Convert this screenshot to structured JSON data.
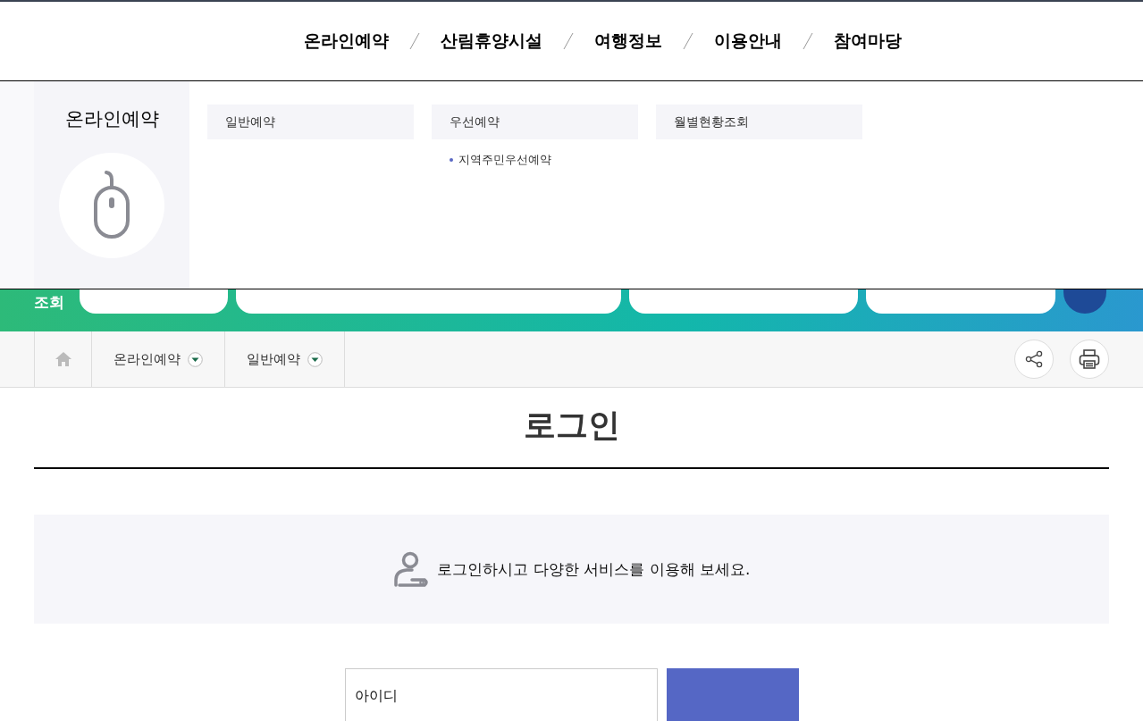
{
  "top_nav": [
    {
      "label": "온라인예약"
    },
    {
      "label": "산림휴양시설"
    },
    {
      "label": "여행정보"
    },
    {
      "label": "이용안내"
    },
    {
      "label": "참여마당"
    }
  ],
  "mega_menu": {
    "title": "온라인예약",
    "columns": [
      {
        "label": "일반예약"
      },
      {
        "label": "우선예약",
        "children": [
          {
            "label": "지역주민우선예약"
          }
        ]
      },
      {
        "label": "월별현황조회"
      }
    ]
  },
  "search_bar": {
    "label": "조회"
  },
  "breadcrumb": [
    {
      "label": "온라인예약"
    },
    {
      "label": "일반예약"
    }
  ],
  "page_title": "로그인",
  "notice": "로그인하시고 다양한 서비스를 이용해 보세요.",
  "login_form": {
    "id_placeholder": "아이디"
  }
}
